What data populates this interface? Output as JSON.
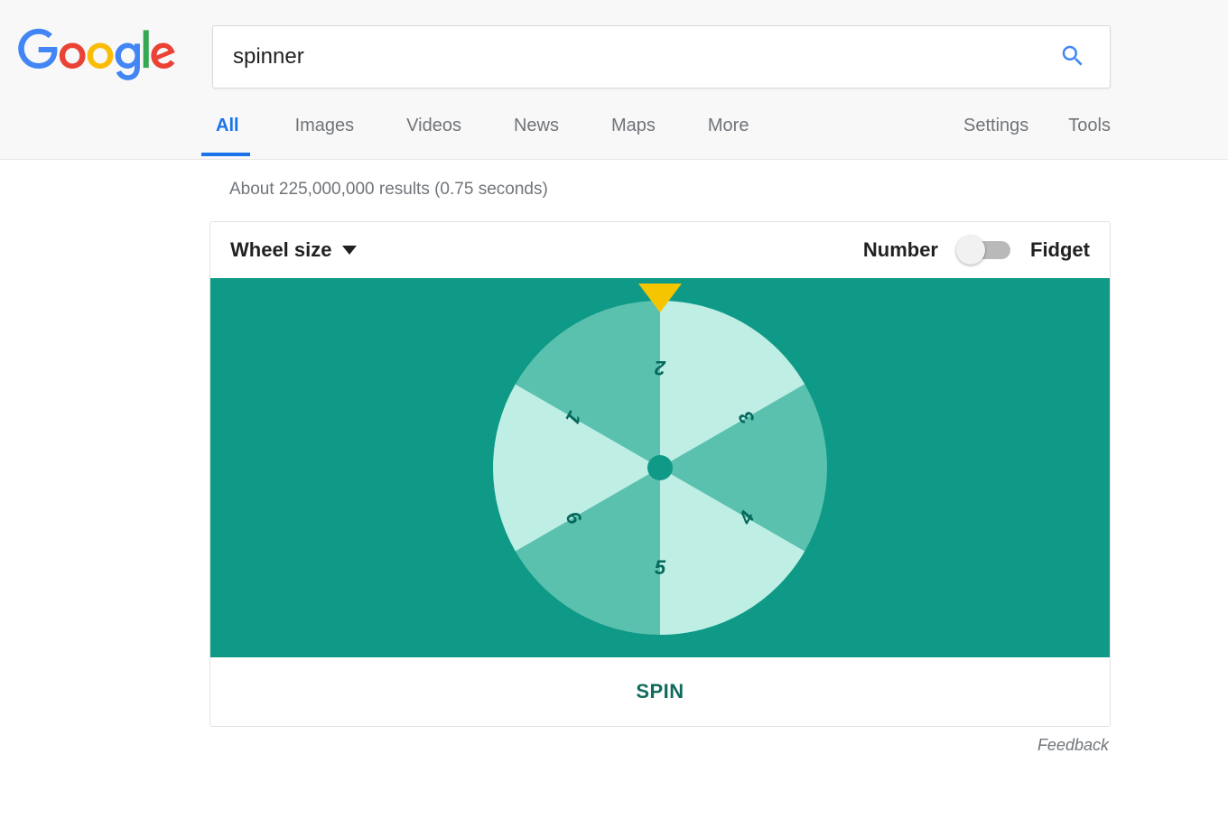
{
  "brand": {
    "name": "Google"
  },
  "search": {
    "query": "spinner"
  },
  "tabs": {
    "all": "All",
    "images": "Images",
    "videos": "Videos",
    "news": "News",
    "maps": "Maps",
    "more": "More",
    "settings": "Settings",
    "tools": "Tools"
  },
  "results": {
    "stats": "About 225,000,000 results (0.75 seconds)"
  },
  "spinner": {
    "wheel_size_label": "Wheel size",
    "mode_number_label": "Number",
    "mode_fidget_label": "Fidget",
    "mode_selected": "Number",
    "spin_label": "SPIN",
    "segments": [
      "1",
      "2",
      "3",
      "4",
      "5",
      "6"
    ],
    "colors": {
      "stage_bg": "#0e9a86",
      "segment_light": "#bfeee5",
      "segment_mid": "#5bc1af",
      "hub": "#0e9a86",
      "pointer": "#f5c500"
    }
  },
  "feedback": {
    "label": "Feedback"
  }
}
